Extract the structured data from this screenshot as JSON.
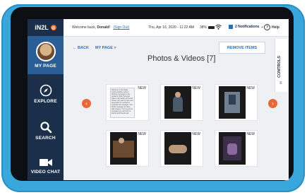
{
  "sidebar": {
    "brand": "iN2L",
    "items": [
      {
        "label": "MY PAGE"
      },
      {
        "label": "EXPLORE"
      },
      {
        "label": "SEARCH"
      },
      {
        "label": "VIDEO CHAT"
      }
    ]
  },
  "topbar": {
    "welcome_prefix": "Welcome back,",
    "user": "Donald!",
    "sign_out": "(Sign Out)",
    "datetime": "Thu, Apr 16, 2020 - 11:22 AM",
    "battery": "38%",
    "notifications": "2 Notifications",
    "help": "Help"
  },
  "page": {
    "back": "BACK",
    "crumb": "MY PAGE >",
    "title": "Photos & Videos [7]",
    "remove": "REMOVE ITEMS",
    "controls": "CONTROLS"
  },
  "tiles": [
    {
      "badge": "NEW",
      "kind": "text",
      "text": "Welcome to the Daisy communication system. Sharing messages to the residents' iN2L Personal Pages with Family & Friends. Please only add a photo and description of yourself to complete the message. Your family message and also take images. If you need the message you can find it in Family and Friends tab."
    },
    {
      "badge": "NEW",
      "kind": "photo"
    },
    {
      "badge": "NEW",
      "kind": "photo"
    },
    {
      "badge": "NEW",
      "kind": "photo"
    },
    {
      "badge": "NEW",
      "kind": "photo"
    },
    {
      "badge": "NEW",
      "kind": "photo"
    }
  ],
  "colors": {
    "accent": "#e8683a",
    "sidebar": "#1b2f4a",
    "link": "#2a6fb8"
  }
}
